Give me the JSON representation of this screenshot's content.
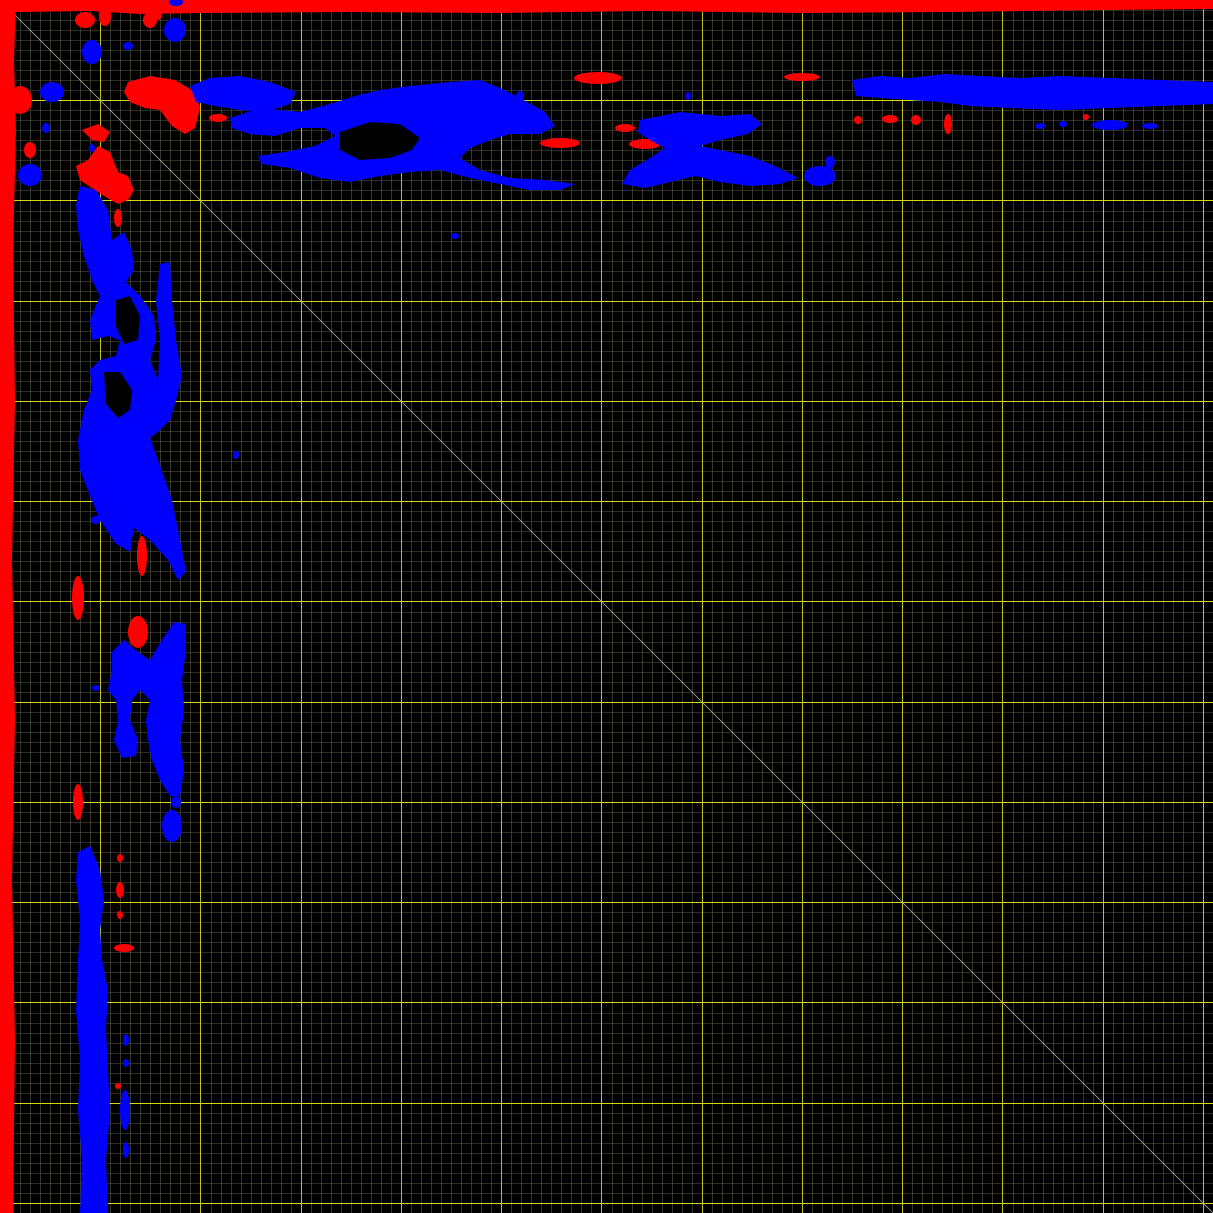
{
  "colors": {
    "background": "#000000",
    "grid_minor": "#5a5a46",
    "grid_major": "#d6d61a",
    "diagonal": "#a8a8a8",
    "positive_contour": "#0000ff",
    "negative_contour": "#ff0000"
  },
  "grid": {
    "visible": true,
    "minor_divisions": 121,
    "major_every": 10
  },
  "diagonal": {
    "visible": true
  }
}
